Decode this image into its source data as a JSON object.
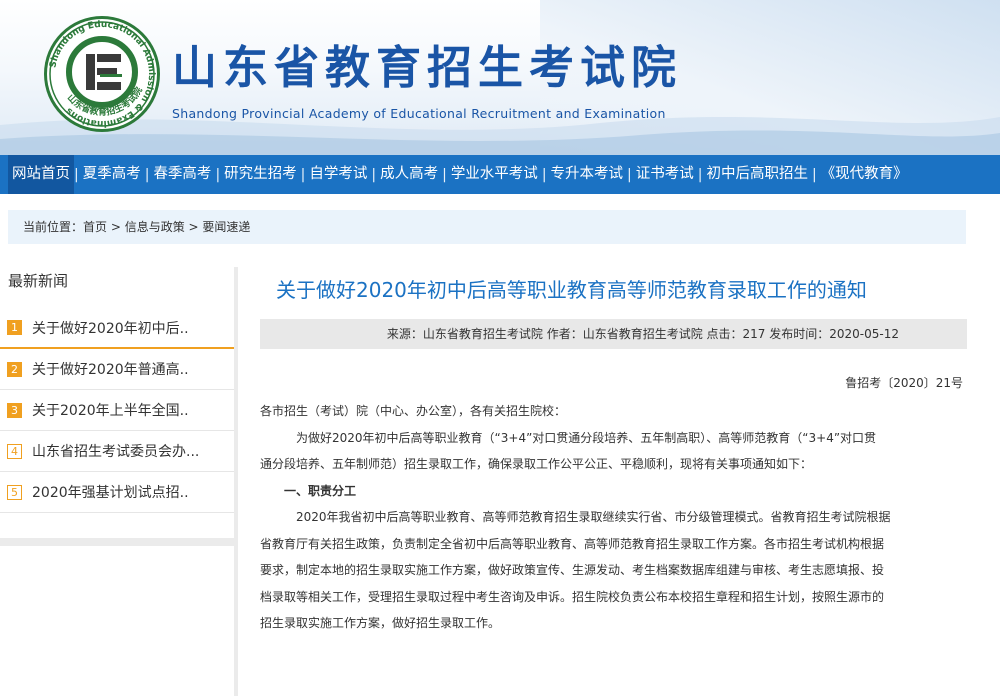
{
  "header": {
    "title_cn": "山东省教育招生考试院",
    "title_en": "Shandong Provincial Academy of Educational Recruitment and Examination",
    "seal_ring_text": "Shandong Educational Admission & Examinations",
    "seal_bottom_text": "山东省教育招生考试院"
  },
  "nav": {
    "items": [
      {
        "label": "网站首页"
      },
      {
        "label": "夏季高考"
      },
      {
        "label": "春季高考"
      },
      {
        "label": "研究生招考"
      },
      {
        "label": "自学考试"
      },
      {
        "label": "成人高考"
      },
      {
        "label": "学业水平考试"
      },
      {
        "label": "专升本考试"
      },
      {
        "label": "证书考试"
      },
      {
        "label": "初中后高职招生"
      },
      {
        "label": "《现代教育》"
      }
    ]
  },
  "breadcrumb": {
    "prefix": "当前位置：",
    "items": [
      "首页",
      "信息与政策",
      "要闻速递"
    ],
    "sep": " > "
  },
  "sidebar": {
    "heading": "最新新闻",
    "items": [
      {
        "num": "1",
        "label": "关于做好2020年初中后.."
      },
      {
        "num": "2",
        "label": "关于做好2020年普通高.."
      },
      {
        "num": "3",
        "label": "关于2020年上半年全国.."
      },
      {
        "num": "4",
        "label": "山东省招生考试委员会办..."
      },
      {
        "num": "5",
        "label": "2020年强基计划试点招.."
      }
    ]
  },
  "article": {
    "title": "关于做好2020年初中后高等职业教育高等师范教育录取工作的通知",
    "meta": "来源：山东省教育招生考试院 作者：山东省教育招生考试院 点击：217 发布时间：2020-05-12",
    "doc_no": "鲁招考〔2020〕21号",
    "addressee": "各市招生（考试）院（中心、办公室），各有关招生院校：",
    "para1_line1": "为做好2020年初中后高等职业教育（“3+4”对口贯通分段培养、五年制高职）、高等师范教育（“3+4”对口贯",
    "para1_line2": "通分段培养、五年制师范）招生录取工作，确保录取工作公平公正、平稳顺利，现将有关事项通知如下：",
    "section1": "一、职责分工",
    "para2_line1": "2020年我省初中后高等职业教育、高等师范教育招生录取继续实行省、市分级管理模式。省教育招生考试院根据",
    "para2_line2": "省教育厅有关招生政策，负责制定全省初中后高等职业教育、高等师范教育招生录取工作方案。各市招生考试机构根据",
    "para2_line3": "要求，制定本地的招生录取实施工作方案，做好政策宣传、生源发动、考生档案数据库组建与审核、考生志愿填报、投",
    "para2_line4": "档录取等相关工作，受理招生录取过程中考生咨询及申诉。招生院校负责公布本校招生章程和招生计划，按照生源市的",
    "para2_line5": "招生录取实施工作方案，做好招生录取工作。"
  },
  "colors": {
    "nav_bg": "#1b72c3",
    "brand_blue": "#1a55a6",
    "accent_orange": "#f0a020",
    "crumb_bg": "#eaf3fb",
    "meta_bg": "#e8e8e8"
  }
}
